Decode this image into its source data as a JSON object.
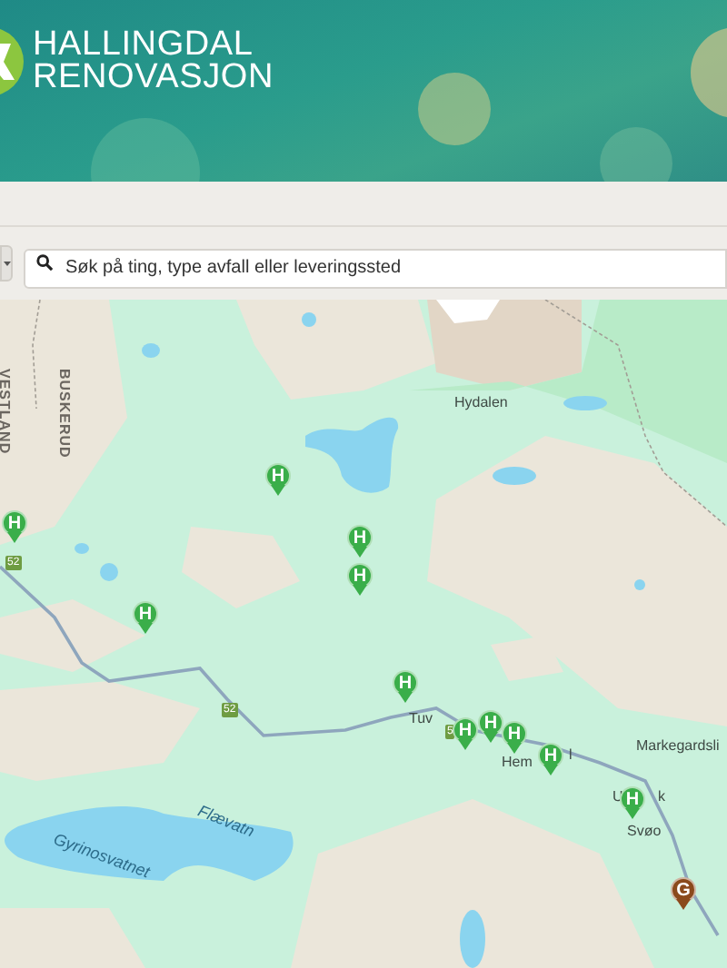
{
  "header": {
    "logo_line_1": "HALLINGDAL",
    "logo_line_2": "RENOVASJON"
  },
  "search": {
    "placeholder": "Søk på ting, type avfall eller leveringssted"
  },
  "map": {
    "labels": [
      {
        "text": "VESTLAND",
        "kind": "region"
      },
      {
        "text": "BUSKERUD",
        "kind": "region"
      },
      {
        "text": "Hydalen",
        "kind": "place"
      },
      {
        "text": "Tuv",
        "kind": "place"
      },
      {
        "text": "Hem",
        "kind": "place"
      },
      {
        "text": "l",
        "kind": "place"
      },
      {
        "text": "Markegardsli",
        "kind": "place"
      },
      {
        "text": "U",
        "kind": "place"
      },
      {
        "text": "k",
        "kind": "place"
      },
      {
        "text": "Svøo",
        "kind": "place"
      },
      {
        "text": "Gyrinosvatnet",
        "kind": "water"
      },
      {
        "text": "Flævatn",
        "kind": "water"
      },
      {
        "text": "52",
        "kind": "road"
      },
      {
        "text": "52",
        "kind": "road"
      },
      {
        "text": "5",
        "kind": "road"
      }
    ],
    "pins": [
      {
        "letter": "H",
        "color": "#3aae4a"
      },
      {
        "letter": "H",
        "color": "#3aae4a"
      },
      {
        "letter": "H",
        "color": "#3aae4a"
      },
      {
        "letter": "H",
        "color": "#3aae4a"
      },
      {
        "letter": "H",
        "color": "#3aae4a"
      },
      {
        "letter": "H",
        "color": "#3aae4a"
      },
      {
        "letter": "H",
        "color": "#3aae4a"
      },
      {
        "letter": "H",
        "color": "#3aae4a"
      },
      {
        "letter": "H",
        "color": "#3aae4a"
      },
      {
        "letter": "H",
        "color": "#3aae4a"
      },
      {
        "letter": "H",
        "color": "#3aae4a"
      },
      {
        "letter": "G",
        "color": "#8b4a1c"
      }
    ]
  }
}
